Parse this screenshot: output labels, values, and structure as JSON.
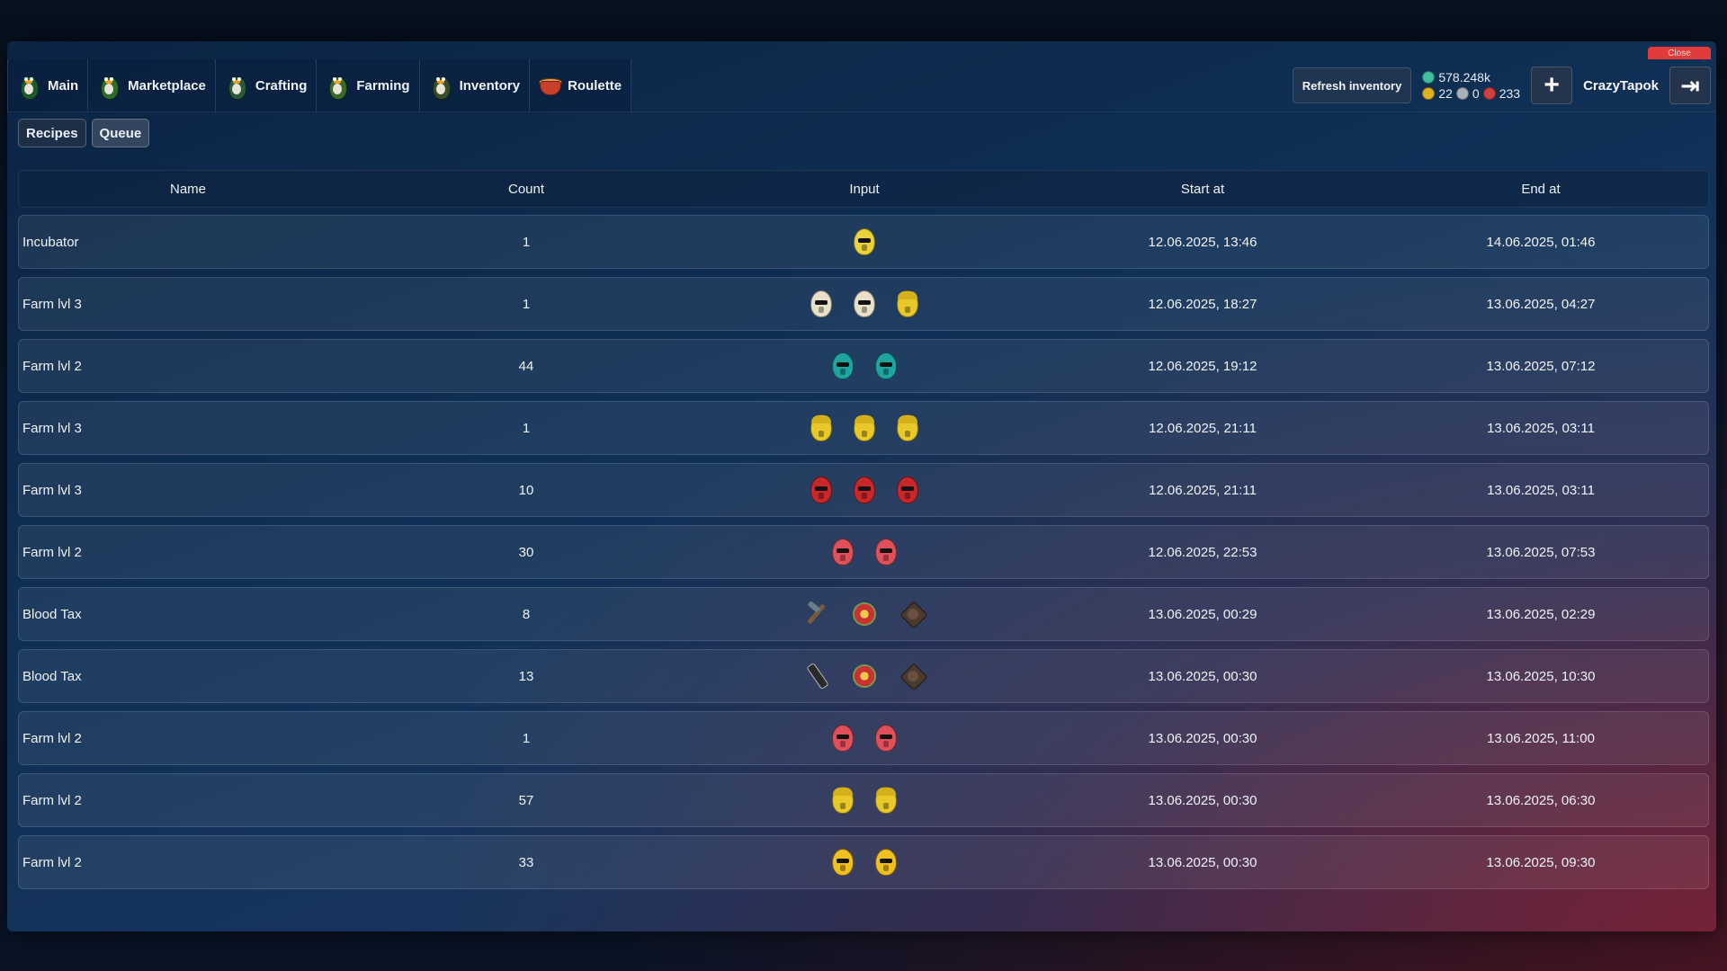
{
  "window": {
    "close_label": "Close"
  },
  "nav": {
    "tabs": [
      {
        "label": "Main",
        "icon": "duck-icon",
        "color": "#1c5a2e"
      },
      {
        "label": "Marketplace",
        "icon": "duck-icon",
        "color": "#2e6a2a"
      },
      {
        "label": "Crafting",
        "icon": "duck-icon",
        "color": "#2a5a3a"
      },
      {
        "label": "Farming",
        "icon": "duck-icon",
        "color": "#3a6a2a"
      },
      {
        "label": "Inventory",
        "icon": "duck-icon",
        "color": "#3a4a2a"
      },
      {
        "label": "Roulette",
        "icon": "roulette-icon",
        "color": "#c8402a"
      }
    ]
  },
  "header": {
    "refresh_label": "Refresh inventory",
    "balance_main": "578.248k",
    "balance_gold": "22",
    "balance_silver": "0",
    "balance_red": "233",
    "username": "CrazyTapok",
    "colors": {
      "gold": "#e0b020",
      "silver": "#a8b0b8",
      "red": "#d04040",
      "main": "#3fbfa0"
    }
  },
  "subtabs": [
    {
      "label": "Recipes"
    },
    {
      "label": "Queue"
    }
  ],
  "table": {
    "columns": [
      "Name",
      "Count",
      "Input",
      "Start at",
      "End at"
    ],
    "rows": [
      {
        "name": "Incubator",
        "count": "1",
        "inputs": [
          {
            "kind": "egg",
            "color": "#e9d23a",
            "style": "skull"
          }
        ],
        "start": "12.06.2025, 13:46",
        "end": "14.06.2025, 01:46"
      },
      {
        "name": "Farm lvl 3",
        "count": "1",
        "inputs": [
          {
            "kind": "egg",
            "color": "#e8e0c8",
            "style": "plain"
          },
          {
            "kind": "egg",
            "color": "#e8e0c8",
            "style": "plain"
          },
          {
            "kind": "egg",
            "color": "#e9c92a",
            "style": "hat"
          }
        ],
        "start": "12.06.2025, 18:27",
        "end": "13.06.2025, 04:27"
      },
      {
        "name": "Farm lvl 2",
        "count": "44",
        "inputs": [
          {
            "kind": "egg",
            "color": "#1fa5a0",
            "style": "plain"
          },
          {
            "kind": "egg",
            "color": "#1fa5a0",
            "style": "plain"
          }
        ],
        "start": "12.06.2025, 19:12",
        "end": "13.06.2025, 07:12"
      },
      {
        "name": "Farm lvl 3",
        "count": "1",
        "inputs": [
          {
            "kind": "egg",
            "color": "#e9c92a",
            "style": "hat"
          },
          {
            "kind": "egg",
            "color": "#e9c92a",
            "style": "hat"
          },
          {
            "kind": "egg",
            "color": "#e9c92a",
            "style": "hat"
          }
        ],
        "start": "12.06.2025, 21:11",
        "end": "13.06.2025, 03:11"
      },
      {
        "name": "Farm lvl 3",
        "count": "10",
        "inputs": [
          {
            "kind": "egg",
            "color": "#c8282a",
            "style": "plain"
          },
          {
            "kind": "egg",
            "color": "#c8282a",
            "style": "plain"
          },
          {
            "kind": "egg",
            "color": "#c8282a",
            "style": "plain"
          }
        ],
        "start": "12.06.2025, 21:11",
        "end": "13.06.2025, 03:11"
      },
      {
        "name": "Farm lvl 2",
        "count": "30",
        "inputs": [
          {
            "kind": "egg",
            "color": "#e0505a",
            "style": "plain"
          },
          {
            "kind": "egg",
            "color": "#e0505a",
            "style": "plain"
          }
        ],
        "start": "12.06.2025, 22:53",
        "end": "13.06.2025, 07:53"
      },
      {
        "name": "Blood Tax",
        "count": "8",
        "inputs": [
          {
            "kind": "item",
            "style": "tool"
          },
          {
            "kind": "item",
            "style": "flower"
          },
          {
            "kind": "item",
            "style": "spiky"
          }
        ],
        "start": "13.06.2025, 00:29",
        "end": "13.06.2025, 02:29"
      },
      {
        "name": "Blood Tax",
        "count": "13",
        "inputs": [
          {
            "kind": "item",
            "style": "bottle"
          },
          {
            "kind": "item",
            "style": "flower"
          },
          {
            "kind": "item",
            "style": "spiky"
          }
        ],
        "start": "13.06.2025, 00:30",
        "end": "13.06.2025, 10:30"
      },
      {
        "name": "Farm lvl 2",
        "count": "1",
        "inputs": [
          {
            "kind": "egg",
            "color": "#e0505a",
            "style": "plain"
          },
          {
            "kind": "egg",
            "color": "#e0505a",
            "style": "plain"
          }
        ],
        "start": "13.06.2025, 00:30",
        "end": "13.06.2025, 11:00"
      },
      {
        "name": "Farm lvl 2",
        "count": "57",
        "inputs": [
          {
            "kind": "egg",
            "color": "#e9c92a",
            "style": "hat"
          },
          {
            "kind": "egg",
            "color": "#e9c92a",
            "style": "hat"
          }
        ],
        "start": "13.06.2025, 00:30",
        "end": "13.06.2025, 06:30"
      },
      {
        "name": "Farm lvl 2",
        "count": "33",
        "inputs": [
          {
            "kind": "egg",
            "color": "#f0c020",
            "style": "plain"
          },
          {
            "kind": "egg",
            "color": "#f0c020",
            "style": "plain"
          }
        ],
        "start": "13.06.2025, 00:30",
        "end": "13.06.2025, 09:30"
      }
    ]
  }
}
